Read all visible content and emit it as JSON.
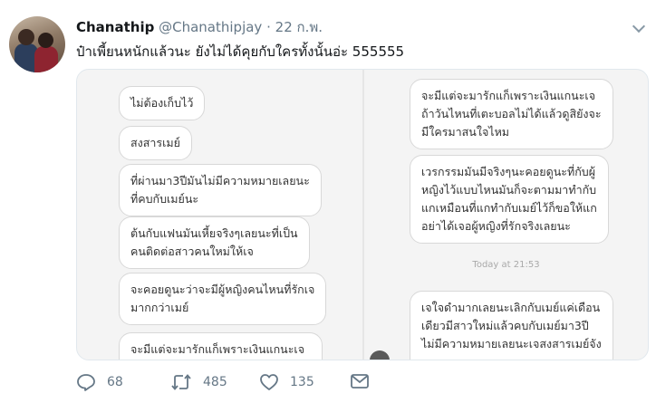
{
  "tweet": {
    "display_name": "Chanathip",
    "handle": "@Chanathipjay",
    "separator": "·",
    "date": "22 ก.พ.",
    "text": "ป๋าเพี้ยนหนักแล้วนะ ยังไม่ได้คุยกับใครทั้งนั้นอ่ะ 555555"
  },
  "chat_screenshot": {
    "left_bubbles": [
      "ไม่ต้องเก็บไว้",
      "สงสารเมย์",
      "ที่ผ่านมา3ปีมันไม่มีความหมายเลยนะ\nที่คบกับเมย์นะ",
      "ต้นกับแฟนมันเหี้ยจริงๆเลยนะที่เป็น\nคนติดต่อสาวคนใหม่ให้เจ",
      "จะคอยดูนะว่าจะมีผู้หญิงคนไหนที่รักเจ\nมากกว่าเมย์",
      "จะมีแต่จะมารักแก็เพราะเงินแกนะเจ\nถ้าวันไหนที่เตะบอลไม่ได้แล้วดูสิยังจะ"
    ],
    "right_bubbles": [
      "จะมีแต่จะมารักแก็เพราะเงินแกนะเจ\nถ้าวันไหนที่เตะบอลไม่ได้แล้วดูสิยังจะ\nมีใครมาสนใจไหม",
      "เวรกรรมมันมีจริงๆนะคอยดูนะที่กับผู้\nหญิงไว้แบบไหนมันก็จะตามมาทำกับ\nแกเหมือนที่แกทำกับเมย์ไว้ก็ขอให้แก\nอย่าได้เจอผู้หญิงที่รักจริงเลยนะ",
      "เจใจดำมากเลยนะเลิกกับเมย์แค่เดือน\nเดียวมีสาวใหม่แล้วคบกับเมย์มา3ปี\nไม่มีความหมายเลยนะเจสงสารเมย์จัง\nเลย"
    ],
    "timestamp": "Today at 21:53"
  },
  "actions": {
    "reply": {
      "icon": "reply-icon",
      "count": "68"
    },
    "retweet": {
      "icon": "retweet-icon",
      "count": "485"
    },
    "like": {
      "icon": "heart-icon",
      "count": "135"
    },
    "message": {
      "icon": "envelope-icon"
    }
  },
  "colors": {
    "muted": "#657786",
    "border": "#e1e8ed",
    "media_bg": "#f4f4f4"
  }
}
